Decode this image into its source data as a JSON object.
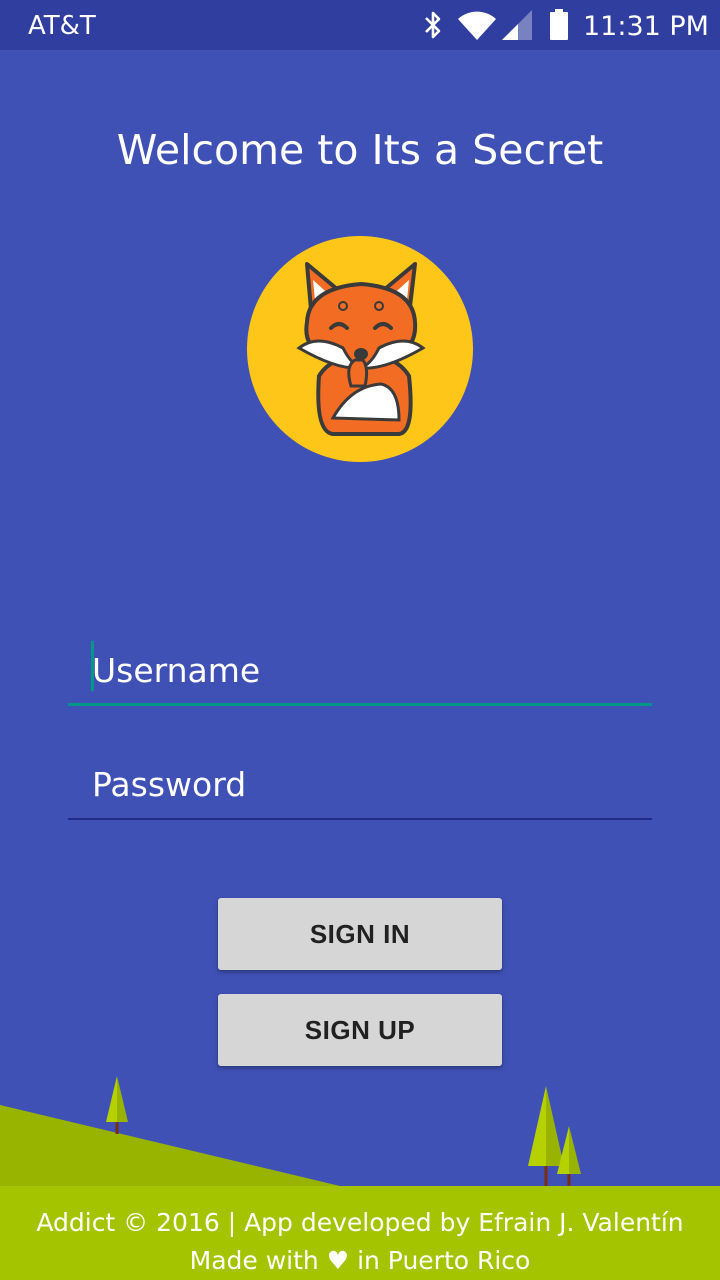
{
  "status_bar": {
    "carrier": "AT&T",
    "time": "11:31 PM",
    "icons": [
      "bluetooth-icon",
      "wifi-icon",
      "signal-icon",
      "battery-icon"
    ]
  },
  "screen": {
    "title": "Welcome to Its a Secret",
    "logo": "fox-shushing-logo"
  },
  "form": {
    "username_placeholder": "Username",
    "username_value": "",
    "password_placeholder": "Password",
    "password_value": ""
  },
  "buttons": {
    "sign_in": "SIGN IN",
    "sign_up": "SIGN UP"
  },
  "footer": {
    "line1": "Addict © 2016 | App developed by Efrain J. Valentín",
    "line2": "Made with ♥ in Puerto Rico"
  },
  "colors": {
    "background": "#3f51b5",
    "status_bar": "#303f9f",
    "accent": "#009688",
    "footer": "#a5c400",
    "button": "#d6d6d6",
    "logo_circle": "#ffc61a",
    "fox_orange": "#f26c23"
  }
}
